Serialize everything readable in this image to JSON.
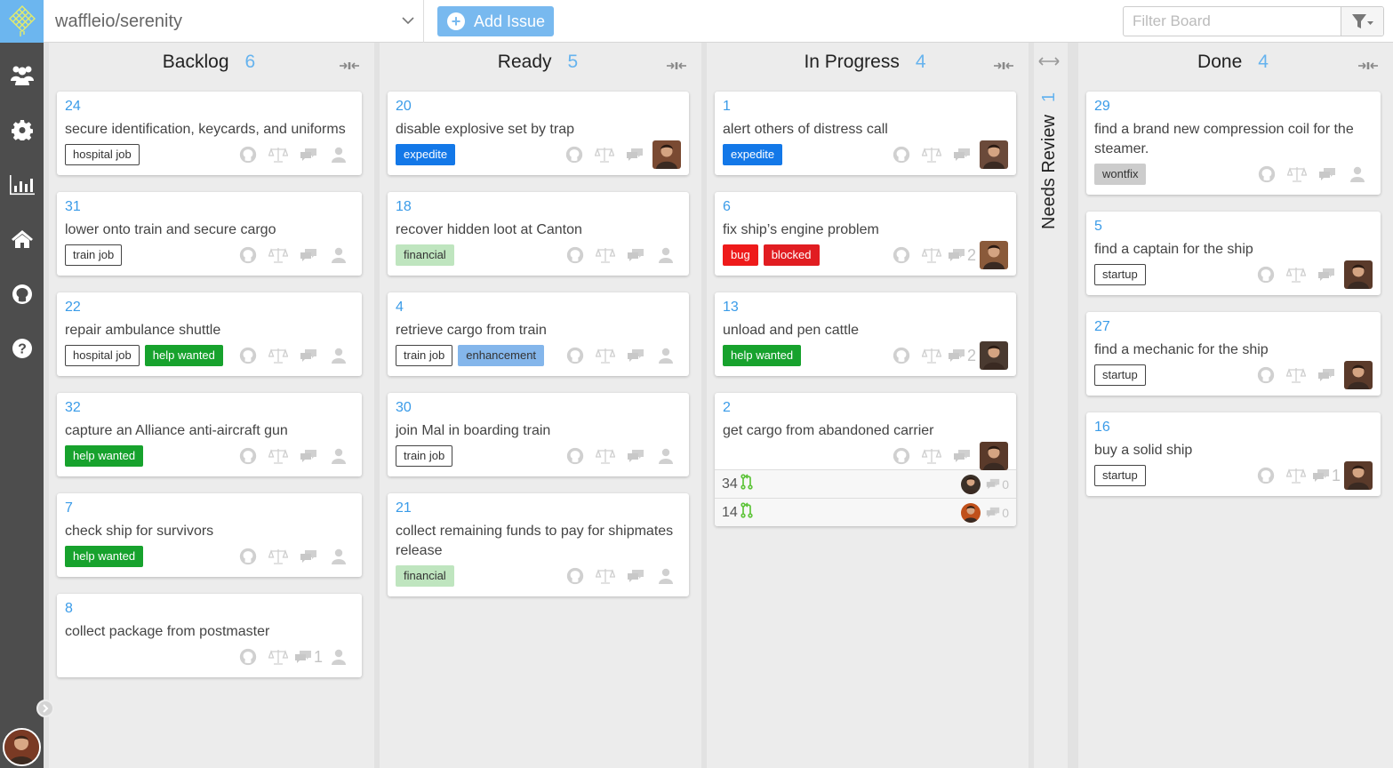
{
  "header": {
    "repo": "waffleio/serenity",
    "add_issue_label": "Add Issue",
    "filter_placeholder": "Filter Board"
  },
  "sidebar": {
    "items": [
      {
        "name": "team-icon",
        "label": "Team"
      },
      {
        "name": "gear-icon",
        "label": "Settings"
      },
      {
        "name": "chart-icon",
        "label": "Metrics"
      },
      {
        "name": "home-icon",
        "label": "Home"
      },
      {
        "name": "github-icon",
        "label": "GitHub"
      },
      {
        "name": "help-icon",
        "label": "Help"
      }
    ]
  },
  "columns": [
    {
      "title": "Backlog",
      "count": "6",
      "cards": [
        {
          "num": "24",
          "title": "secure identification, keycards, and uniforms",
          "labels": [
            {
              "text": "hospital job",
              "style": "outline"
            }
          ],
          "comments": "",
          "assignee": null
        },
        {
          "num": "31",
          "title": "lower onto train and secure cargo",
          "labels": [
            {
              "text": "train job",
              "style": "outline"
            }
          ],
          "comments": "",
          "assignee": null
        },
        {
          "num": "22",
          "title": "repair ambulance shuttle",
          "labels": [
            {
              "text": "hospital job",
              "style": "outline"
            },
            {
              "text": "help wanted",
              "style": "green"
            }
          ],
          "comments": "",
          "assignee": null
        },
        {
          "num": "32",
          "title": "capture an Alliance anti-aircraft gun",
          "labels": [
            {
              "text": "help wanted",
              "style": "green"
            }
          ],
          "comments": "",
          "assignee": null
        },
        {
          "num": "7",
          "title": "check ship for survivors",
          "labels": [
            {
              "text": "help wanted",
              "style": "green"
            }
          ],
          "comments": "",
          "assignee": null
        },
        {
          "num": "8",
          "title": "collect package from postmaster",
          "labels": [],
          "comments": "1",
          "assignee": null
        }
      ]
    },
    {
      "title": "Ready",
      "count": "5",
      "cards": [
        {
          "num": "20",
          "title": "disable explosive set by trap",
          "labels": [
            {
              "text": "expedite",
              "style": "expedite"
            }
          ],
          "comments": "",
          "assignee": "#7a4a32"
        },
        {
          "num": "18",
          "title": "recover hidden loot at Canton",
          "labels": [
            {
              "text": "financial",
              "style": "financial"
            }
          ],
          "comments": "",
          "assignee": null
        },
        {
          "num": "4",
          "title": "retrieve cargo from train",
          "labels": [
            {
              "text": "train job",
              "style": "outline"
            },
            {
              "text": "enhancement",
              "style": "enh"
            }
          ],
          "comments": "",
          "assignee": null
        },
        {
          "num": "30",
          "title": "join Mal in boarding train",
          "labels": [
            {
              "text": "train job",
              "style": "outline"
            }
          ],
          "comments": "",
          "assignee": null
        },
        {
          "num": "21",
          "title": "collect remaining funds to pay for shipmates release",
          "labels": [
            {
              "text": "financial",
              "style": "financial"
            }
          ],
          "comments": "",
          "assignee": null
        }
      ]
    },
    {
      "title": "In Progress",
      "count": "4",
      "cards": [
        {
          "num": "1",
          "title": "alert others of distress call",
          "labels": [
            {
              "text": "expedite",
              "style": "expedite"
            }
          ],
          "comments": "",
          "assignee": "#6b4a3a"
        },
        {
          "num": "6",
          "title": "fix ship’s engine problem",
          "labels": [
            {
              "text": "bug",
              "style": "bug"
            },
            {
              "text": "blocked",
              "style": "blocked"
            }
          ],
          "comments": "2",
          "assignee": "#8a5a3a"
        },
        {
          "num": "13",
          "title": "unload and pen cattle",
          "labels": [
            {
              "text": "help wanted",
              "style": "green"
            }
          ],
          "comments": "2",
          "assignee": "#4a3a30"
        },
        {
          "num": "2",
          "title": "get cargo from abandoned carrier",
          "labels": [],
          "comments": "",
          "assignee": "#5a3a2a",
          "pull_requests": [
            {
              "num": "34",
              "comments": "0",
              "avatar": "#3a3028"
            },
            {
              "num": "14",
              "comments": "0",
              "avatar": "#c0501a"
            }
          ]
        }
      ]
    },
    {
      "title": "Needs Review",
      "count": "1",
      "collapsed": true,
      "cards": []
    },
    {
      "title": "Done",
      "count": "4",
      "cards": [
        {
          "num": "29",
          "title": "find a brand new compression coil for the steamer.",
          "labels": [
            {
              "text": "wontfix",
              "style": "wontfix"
            }
          ],
          "comments": "",
          "assignee": null
        },
        {
          "num": "5",
          "title": "find a captain for the ship",
          "labels": [
            {
              "text": "startup",
              "style": "outline"
            }
          ],
          "comments": "",
          "assignee": "#5a3a2a"
        },
        {
          "num": "27",
          "title": "find a mechanic for the ship",
          "labels": [
            {
              "text": "startup",
              "style": "outline"
            }
          ],
          "comments": "",
          "assignee": "#5a3a2a"
        },
        {
          "num": "16",
          "title": "buy a solid ship",
          "labels": [
            {
              "text": "startup",
              "style": "outline"
            }
          ],
          "comments": "1",
          "assignee": "#5a3a2a"
        }
      ]
    }
  ],
  "colors": {
    "brand": "#6cb6ef",
    "accent": "#3a9be8",
    "sidebar": "#4d4d4d"
  }
}
